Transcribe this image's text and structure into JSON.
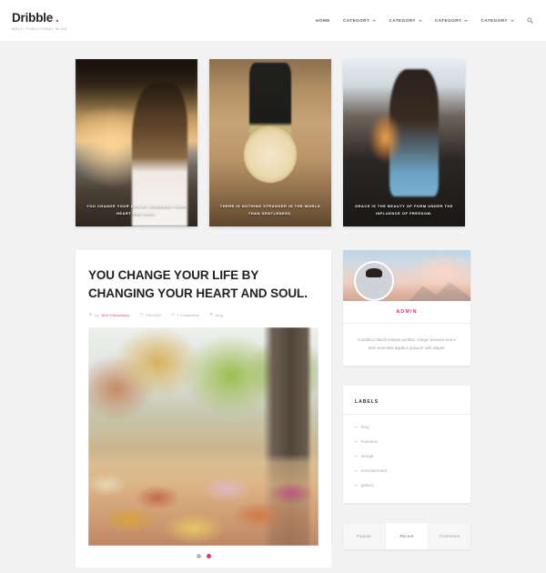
{
  "header": {
    "brand": {
      "title": "Dribble",
      "dot": ".",
      "subtitle": "MULTI FUNCTIONAL BLOG"
    },
    "nav": [
      {
        "label": "HOME",
        "has_caret": false
      },
      {
        "label": "CATEGORY",
        "has_caret": true
      },
      {
        "label": "CATEGORY",
        "has_caret": true
      },
      {
        "label": "CATEGORY",
        "has_caret": true
      },
      {
        "label": "CATEGORY",
        "has_caret": true
      }
    ],
    "search_icon": "search-icon"
  },
  "hero": {
    "cards": [
      {
        "caption": "YOU CHANGE YOUR LIFE BY CHANGING YOUR HEART AND SOUL."
      },
      {
        "caption": "THERE IS NOTHING STRANGER IN THE WORLD THAN GENTLENESS."
      },
      {
        "caption": "GRACE IS THE BEAUTY OF FORM UNDER THE INFLUENCE OF FREEDOM."
      }
    ]
  },
  "post": {
    "title": "YOU CHANGE YOUR LIFE BY CHANGING YOUR HEART AND SOUL.",
    "meta": {
      "author_prefix": "by",
      "author": "Bret Chaudhary",
      "date": "7/8/2015",
      "comments": "7 Comments",
      "tag": "blog"
    },
    "image_alt": "autumn leaves on ground beside tree trunk",
    "dots": [
      {
        "active": false
      },
      {
        "active": true
      }
    ]
  },
  "sidebar": {
    "author_widget": {
      "name": "ADMIN",
      "about": "Curabitur blandit tempus porttitor. Integer posuere erat a ante venenatis dapibus posuere velit aliquet."
    },
    "labels_widget": {
      "title": "LABELS",
      "items": [
        {
          "label": "blog"
        },
        {
          "label": "business"
        },
        {
          "label": "design"
        },
        {
          "label": "entertainment"
        },
        {
          "label": "gallery"
        }
      ]
    },
    "tabs_widget": {
      "tabs": [
        {
          "label": "Popular",
          "active": false
        },
        {
          "label": "Recent",
          "active": true
        },
        {
          "label": "Comments",
          "active": false
        }
      ]
    }
  },
  "colors": {
    "accent": "#f0316a",
    "page_bg": "#f2f2f2",
    "card_bg": "#ffffff",
    "text": "#232323",
    "muted": "#a3a3a3"
  }
}
